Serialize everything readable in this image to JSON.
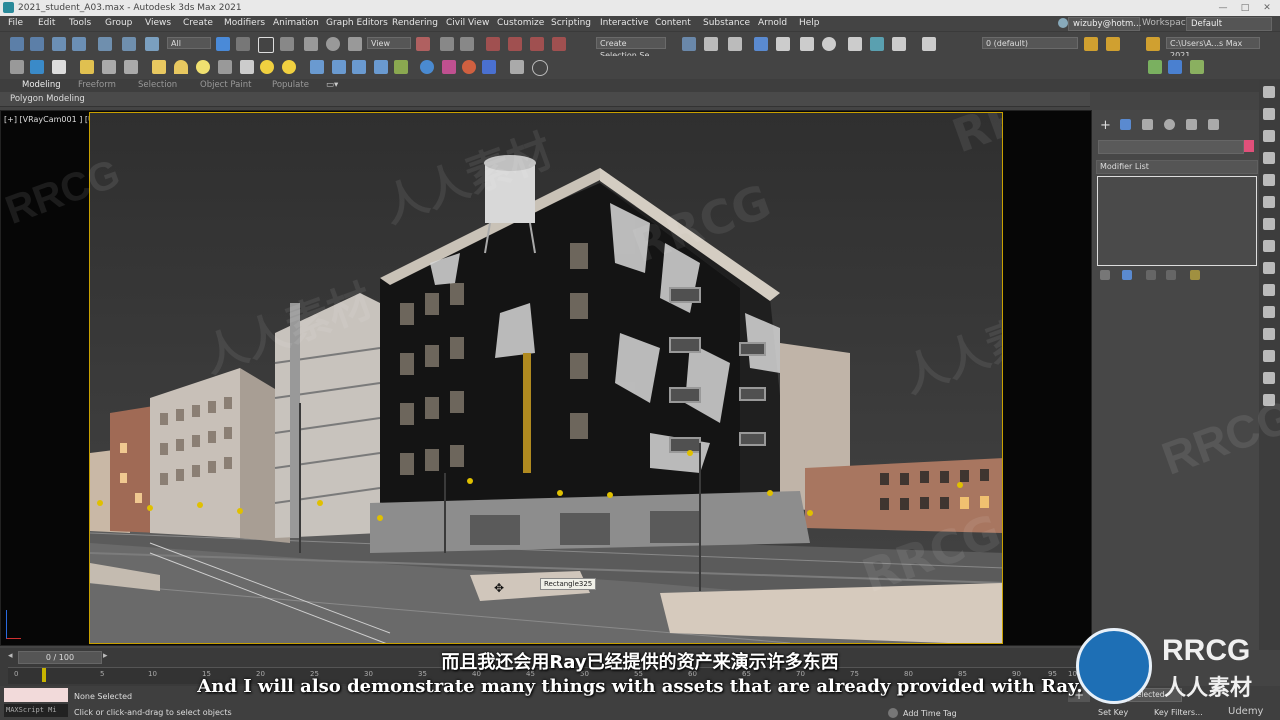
{
  "app": {
    "title": "2021_student_A03.max - Autodesk 3ds Max 2021",
    "window_controls": [
      "—",
      "□",
      "✕"
    ]
  },
  "menu": {
    "items": [
      "File",
      "Edit",
      "Tools",
      "Group",
      "Views",
      "Create",
      "Modifiers",
      "Animation",
      "Graph Editors",
      "Rendering",
      "Civil View",
      "Customize",
      "Scripting",
      "Interactive",
      "Content",
      "Substance",
      "Arnold",
      "Help"
    ],
    "user": "wizuby@hotm...",
    "workspaces_label": "Workspaces:",
    "workspace_value": "Default"
  },
  "toolbar": {
    "filter_value": "All",
    "refcoord_value": "View",
    "selection_set_placeholder": "Create Selection Se",
    "layer_value": "0 (default)",
    "project_path": "C:\\Users\\A...s Max 2021"
  },
  "ribbon": {
    "tabs": [
      "Modeling",
      "Freeform",
      "Selection",
      "Object Paint",
      "Populate"
    ],
    "subtitle": "Polygon Modeling"
  },
  "viewport": {
    "label": "[+] [VRayCam001 ] [User Defined ] [Default Shading ]",
    "tooltip": "Rectangle325"
  },
  "command_panel": {
    "modifier_list_label": "Modifier List",
    "color_swatch": "#e0507a"
  },
  "timeline": {
    "frame_counter": "0 / 100",
    "ticks": [
      "0",
      "5",
      "10",
      "15",
      "20",
      "25",
      "30",
      "35",
      "40",
      "45",
      "50",
      "55",
      "60",
      "65",
      "70",
      "75",
      "80",
      "85",
      "90",
      "95",
      "100"
    ]
  },
  "status": {
    "script_placeholder": "MAXScript Mi",
    "selection_status": "None Selected",
    "prompt": "Click or click-and-drag to select objects",
    "add_time_tag": "Add Time Tag",
    "set_key": "Set Key",
    "key_filters": "Key Filters...",
    "selected_dropdown": "Selected"
  },
  "subtitles": {
    "chinese": "而且我还会用Ray已经提供的资产来演示许多东西",
    "english": "And I will also demonstrate many things with assets that are already provided with Ray."
  },
  "watermark": {
    "brand": "RRCG",
    "brand_cn": "人人素材",
    "udemy": "Udemy"
  }
}
